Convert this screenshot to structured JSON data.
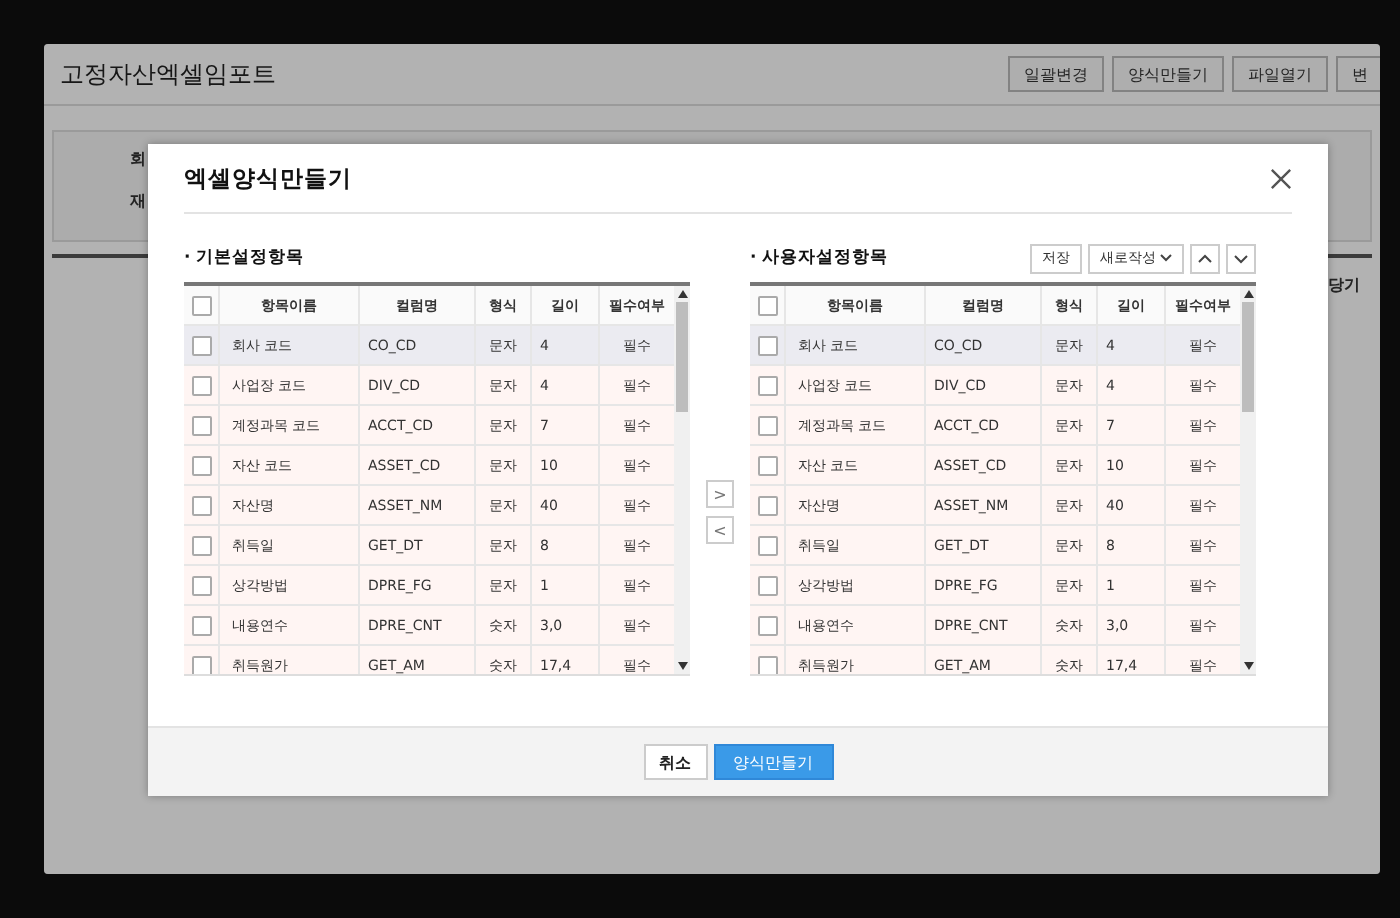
{
  "page": {
    "title": "고정자산엑셀임포트",
    "buttons": [
      "일괄변경",
      "양식만들기",
      "파일열기",
      "변"
    ],
    "labels": [
      "회",
      "재"
    ],
    "column_header": "당기"
  },
  "modal": {
    "title": "엑셀양식만들기",
    "left": {
      "title": "· 기본설정항목",
      "all_checked": false,
      "columns": [
        "항목이름",
        "컬럼명",
        "형식",
        "길이",
        "필수여부"
      ],
      "rows": [
        {
          "cells": [
            "회사 코드",
            "CO_CD",
            "문자",
            "4",
            "필수"
          ],
          "selected": true,
          "checked": false
        },
        {
          "cells": [
            "사업장 코드",
            "DIV_CD",
            "문자",
            "4",
            "필수"
          ],
          "selected": false,
          "checked": false
        },
        {
          "cells": [
            "계정과목 코드",
            "ACCT_CD",
            "문자",
            "7",
            "필수"
          ],
          "selected": false,
          "checked": false
        },
        {
          "cells": [
            "자산 코드",
            "ASSET_CD",
            "문자",
            "10",
            "필수"
          ],
          "selected": false,
          "checked": false
        },
        {
          "cells": [
            "자산명",
            "ASSET_NM",
            "문자",
            "40",
            "필수"
          ],
          "selected": false,
          "checked": false
        },
        {
          "cells": [
            "취득일",
            "GET_DT",
            "문자",
            "8",
            "필수"
          ],
          "selected": false,
          "checked": false
        },
        {
          "cells": [
            "상각방법",
            "DPRE_FG",
            "문자",
            "1",
            "필수"
          ],
          "selected": false,
          "checked": false
        },
        {
          "cells": [
            "내용연수",
            "DPRE_CNT",
            "숫자",
            "3,0",
            "필수"
          ],
          "selected": false,
          "checked": false
        },
        {
          "cells": [
            "취득원가",
            "GET_AM",
            "숫자",
            "17,4",
            "필수"
          ],
          "selected": false,
          "checked": false
        }
      ]
    },
    "move_buttons": [
      ">",
      "<"
    ],
    "right": {
      "title": "· 사용자설정항목",
      "all_checked": false,
      "save": "저장",
      "new": "새로작성",
      "columns": [
        "항목이름",
        "컬럼명",
        "형식",
        "길이",
        "필수여부"
      ],
      "rows": [
        {
          "cells": [
            "회사 코드",
            "CO_CD",
            "문자",
            "4",
            "필수"
          ],
          "selected": true,
          "checked": false
        },
        {
          "cells": [
            "사업장 코드",
            "DIV_CD",
            "문자",
            "4",
            "필수"
          ],
          "selected": false,
          "checked": false
        },
        {
          "cells": [
            "계정과목 코드",
            "ACCT_CD",
            "문자",
            "7",
            "필수"
          ],
          "selected": false,
          "checked": false
        },
        {
          "cells": [
            "자산 코드",
            "ASSET_CD",
            "문자",
            "10",
            "필수"
          ],
          "selected": false,
          "checked": false
        },
        {
          "cells": [
            "자산명",
            "ASSET_NM",
            "문자",
            "40",
            "필수"
          ],
          "selected": false,
          "checked": false
        },
        {
          "cells": [
            "취득일",
            "GET_DT",
            "문자",
            "8",
            "필수"
          ],
          "selected": false,
          "checked": false
        },
        {
          "cells": [
            "상각방법",
            "DPRE_FG",
            "문자",
            "1",
            "필수"
          ],
          "selected": false,
          "checked": false
        },
        {
          "cells": [
            "내용연수",
            "DPRE_CNT",
            "숫자",
            "3,0",
            "필수"
          ],
          "selected": false,
          "checked": false
        },
        {
          "cells": [
            "취득원가",
            "GET_AM",
            "숫자",
            "17,4",
            "필수"
          ],
          "selected": false,
          "checked": false
        }
      ]
    },
    "cancel": "취소",
    "submit": "양식만들기"
  }
}
